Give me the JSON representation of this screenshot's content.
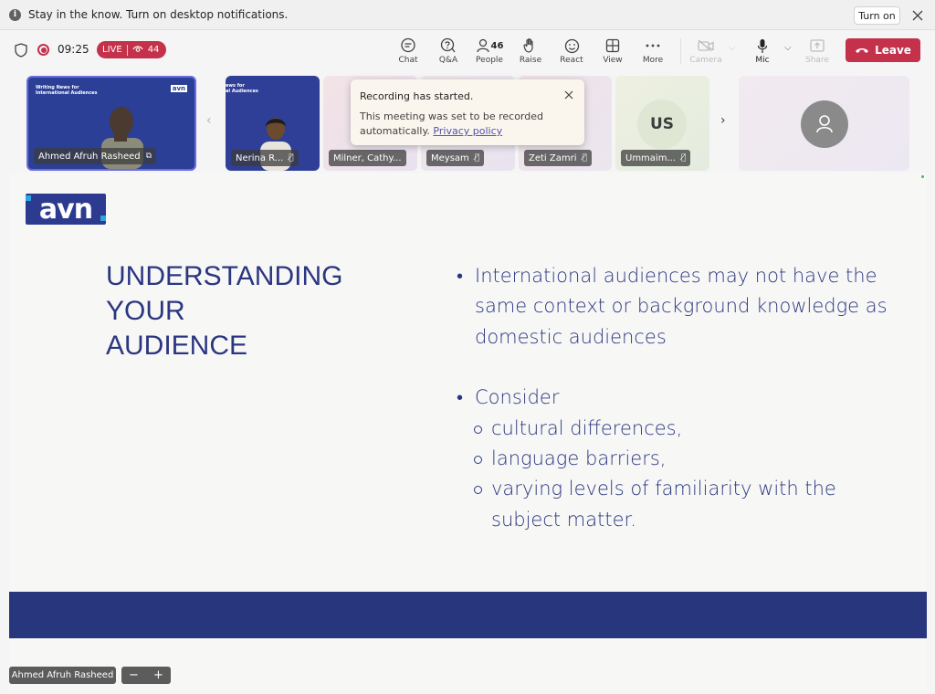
{
  "notification": {
    "text": "Stay in the know. Turn on desktop notifications.",
    "turn_on_label": "Turn on",
    "info_icon": "i"
  },
  "meeting": {
    "timer": "09:25",
    "live_label": "LIVE",
    "viewers": "44",
    "accent_color": "#c4314b"
  },
  "toolbar": {
    "chat": "Chat",
    "qa": "Q&A",
    "people": "People",
    "people_count": "46",
    "raise": "Raise",
    "react": "React",
    "view": "View",
    "more": "More",
    "camera": "Camera",
    "mic": "Mic",
    "share": "Share",
    "leave": "Leave"
  },
  "participants": [
    {
      "name": "Ahmed Afruh Rasheed"
    },
    {
      "name": "Nerina R..."
    },
    {
      "name": "Milner, Cathy..."
    },
    {
      "name": "Meysam"
    },
    {
      "name": "Zeti Zamri"
    },
    {
      "name": "Ummaim...",
      "initials": "US"
    }
  ],
  "toast": {
    "title": "Recording has started.",
    "body": "This meeting was set to be recorded automatically.",
    "link": "Privacy policy"
  },
  "slide": {
    "logo": "avn",
    "title_lines": [
      "UNDERSTANDING",
      "YOUR",
      "AUDIENCE"
    ],
    "bullet1": "International audiences may not have the same context or background knowledge as domestic audiences",
    "bullet2": "Consider",
    "sub_bullets": [
      "cultural differences,",
      "language barriers,",
      "varying levels of familiarity with the subject matter."
    ],
    "title_color": "#2c3680",
    "band_color": "#28367d"
  },
  "presenter": {
    "name": "Ahmed Afruh Rasheed",
    "zoom_out": "−",
    "zoom_in": "+"
  },
  "tile_slide": {
    "heading1": "Writing News for",
    "heading2": "International Audiences",
    "partial1": "ews for",
    "partial2": "al Audiences"
  }
}
